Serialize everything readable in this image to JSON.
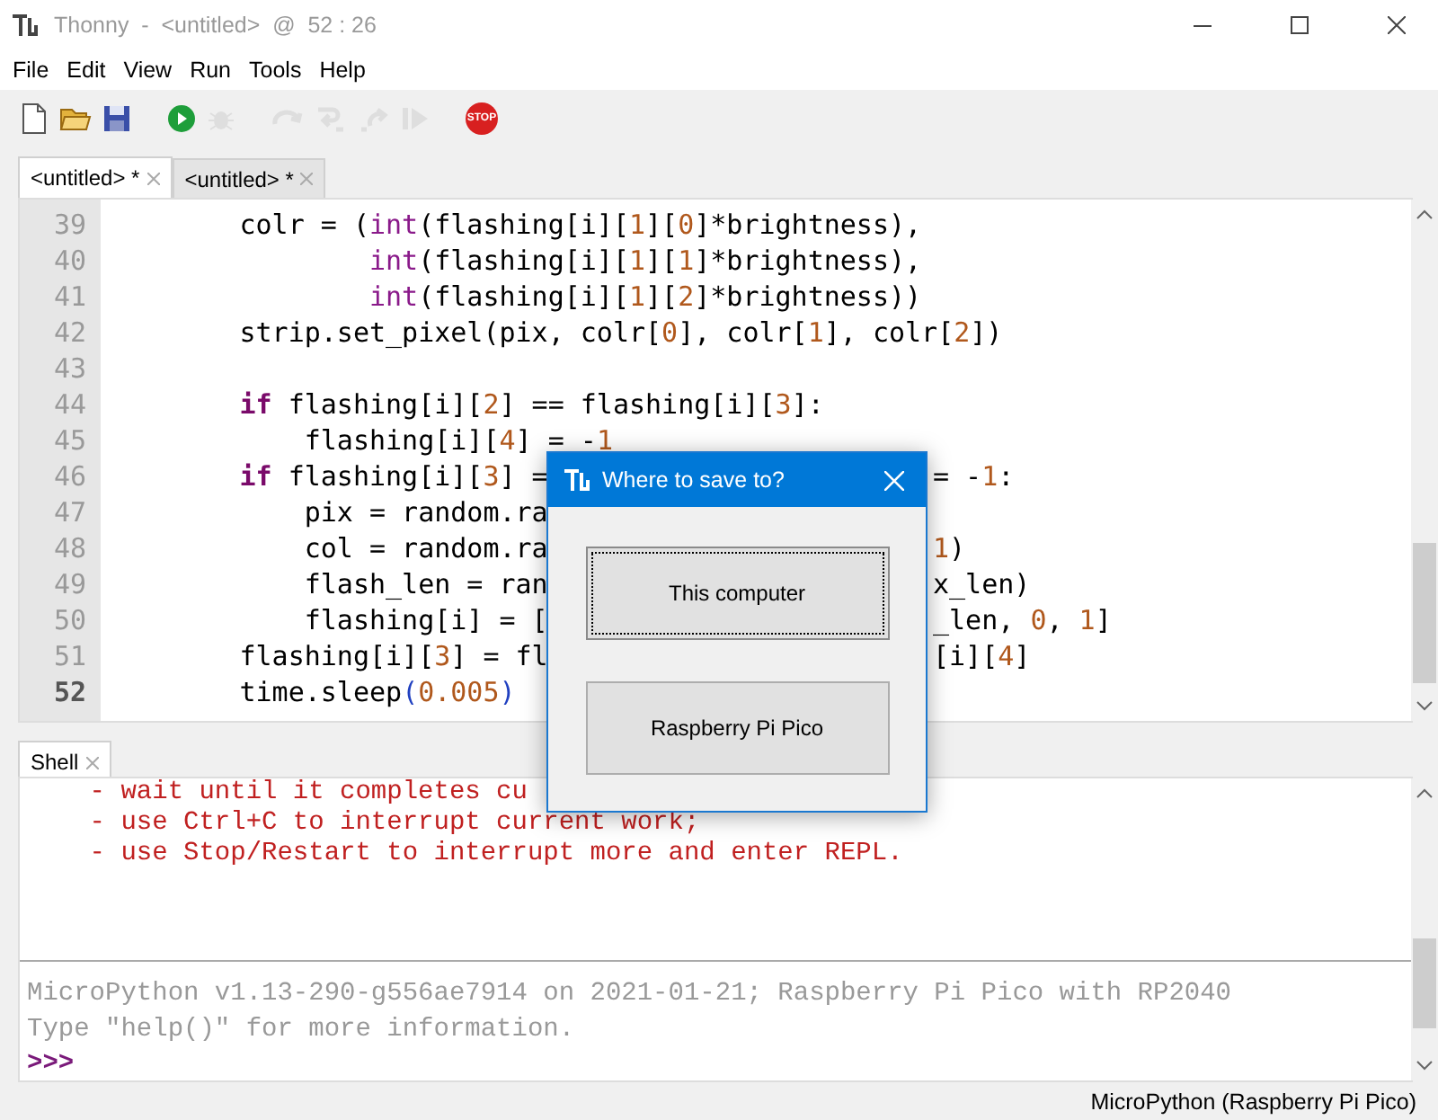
{
  "window": {
    "title": "Thonny  -  <untitled>  @  52 : 26"
  },
  "menu": [
    "File",
    "Edit",
    "View",
    "Run",
    "Tools",
    "Help"
  ],
  "toolbar": [
    {
      "kind": "new",
      "disabled": false
    },
    {
      "kind": "open",
      "disabled": false
    },
    {
      "kind": "save",
      "disabled": false
    },
    {
      "kind": "run",
      "disabled": false
    },
    {
      "kind": "debug",
      "disabled": true
    },
    {
      "kind": "step_over",
      "disabled": true
    },
    {
      "kind": "step_into",
      "disabled": true
    },
    {
      "kind": "step_out",
      "disabled": true
    },
    {
      "kind": "resume",
      "disabled": true
    },
    {
      "kind": "stop",
      "disabled": false,
      "label": "STOP"
    }
  ],
  "editor_tabs": [
    {
      "label": "<untitled> *",
      "selected": true
    },
    {
      "label": "<untitled> *",
      "selected": false
    }
  ],
  "code_lines": [
    {
      "number": "39",
      "current": false,
      "tokens": [
        {
          "text": "        colr = (",
          "kind": "plain"
        },
        {
          "text": "int",
          "kind": "builtin"
        },
        {
          "text": "(flashing[i][",
          "kind": "plain"
        },
        {
          "text": "1",
          "kind": "num"
        },
        {
          "text": "][",
          "kind": "plain"
        },
        {
          "text": "0",
          "kind": "num"
        },
        {
          "text": "]*brightness),",
          "kind": "plain"
        }
      ]
    },
    {
      "number": "40",
      "current": false,
      "tokens": [
        {
          "text": "                int",
          "kind": "builtin"
        },
        {
          "text": "(flashing[i][",
          "kind": "plain"
        },
        {
          "text": "1",
          "kind": "num"
        },
        {
          "text": "][",
          "kind": "plain"
        },
        {
          "text": "1",
          "kind": "num"
        },
        {
          "text": "]*brightness),",
          "kind": "plain"
        }
      ]
    },
    {
      "number": "41",
      "current": false,
      "tokens": [
        {
          "text": "                int",
          "kind": "builtin"
        },
        {
          "text": "(flashing[i][",
          "kind": "plain"
        },
        {
          "text": "1",
          "kind": "num"
        },
        {
          "text": "][",
          "kind": "plain"
        },
        {
          "text": "2",
          "kind": "num"
        },
        {
          "text": "]*brightness))",
          "kind": "plain"
        }
      ]
    },
    {
      "number": "42",
      "current": false,
      "tokens": [
        {
          "text": "        strip.set_pixel(pix, colr[",
          "kind": "plain"
        },
        {
          "text": "0",
          "kind": "num"
        },
        {
          "text": "], colr[",
          "kind": "plain"
        },
        {
          "text": "1",
          "kind": "num"
        },
        {
          "text": "], colr[",
          "kind": "plain"
        },
        {
          "text": "2",
          "kind": "num"
        },
        {
          "text": "])",
          "kind": "plain"
        }
      ]
    },
    {
      "number": "43",
      "current": false
    },
    {
      "number": "44",
      "current": false,
      "tokens": [
        {
          "text": "        if",
          "kind": "keyword"
        },
        {
          "text": " flashing[i][",
          "kind": "plain"
        },
        {
          "text": "2",
          "kind": "num"
        },
        {
          "text": "] == flashing[i][",
          "kind": "plain"
        },
        {
          "text": "3",
          "kind": "num"
        },
        {
          "text": "]:",
          "kind": "plain"
        }
      ]
    },
    {
      "number": "45",
      "current": false,
      "tokens": [
        {
          "text": "            flashing[i][",
          "kind": "plain"
        },
        {
          "text": "4",
          "kind": "num"
        },
        {
          "text": "] = -",
          "kind": "plain"
        },
        {
          "text": "1",
          "kind": "num"
        }
      ]
    },
    {
      "number": "46",
      "current": false,
      "tokens": [
        {
          "text": "        if",
          "kind": "keyword"
        },
        {
          "text": " flashing[i][",
          "kind": "plain"
        },
        {
          "text": "3",
          "kind": "num"
        },
        {
          "text": "] =",
          "kind": "plain"
        }
      ],
      "after_dialog": [
        {
          "text": "= -",
          "kind": "plain"
        },
        {
          "text": "1",
          "kind": "num"
        },
        {
          "text": ":",
          "kind": "plain"
        }
      ]
    },
    {
      "number": "47",
      "current": false,
      "tokens": [
        {
          "text": "            pix = random.ra",
          "kind": "plain"
        }
      ]
    },
    {
      "number": "48",
      "current": false,
      "tokens": [
        {
          "text": "            col = random.ra",
          "kind": "plain"
        }
      ],
      "after_dialog": [
        {
          "text": "1",
          "kind": "num"
        },
        {
          "text": ")",
          "kind": "plain"
        }
      ]
    },
    {
      "number": "49",
      "current": false,
      "tokens": [
        {
          "text": "            flash_len = ran",
          "kind": "plain"
        }
      ],
      "after_dialog": [
        {
          "text": "x_len)",
          "kind": "plain"
        }
      ]
    },
    {
      "number": "50",
      "current": false,
      "tokens": [
        {
          "text": "            flashing[i] = [",
          "kind": "plain"
        }
      ],
      "after_dialog": [
        {
          "text": "_len, ",
          "kind": "plain"
        },
        {
          "text": "0",
          "kind": "num"
        },
        {
          "text": ", ",
          "kind": "plain"
        },
        {
          "text": "1",
          "kind": "num"
        },
        {
          "text": "]",
          "kind": "plain"
        }
      ]
    },
    {
      "number": "51",
      "current": false,
      "tokens": [
        {
          "text": "        flashing[i][",
          "kind": "plain"
        },
        {
          "text": "3",
          "kind": "num"
        },
        {
          "text": "] = fl",
          "kind": "plain"
        }
      ],
      "after_dialog": [
        {
          "text": "[i][",
          "kind": "plain"
        },
        {
          "text": "4",
          "kind": "num"
        },
        {
          "text": "]",
          "kind": "plain"
        }
      ]
    },
    {
      "number": "52",
      "current": true,
      "tokens": [
        {
          "text": "        time.sleep",
          "kind": "plain"
        },
        {
          "text": "(",
          "kind": "paren"
        },
        {
          "text": "0.005",
          "kind": "num"
        },
        {
          "text": ")",
          "kind": "paren"
        }
      ]
    }
  ],
  "shell_tab": {
    "label": "Shell",
    "selected": true
  },
  "shell_output": [
    "    - wait until it completes cu",
    "    - use Ctrl+C to interrupt current work;",
    "    - use Stop/Restart to interrupt more and enter REPL."
  ],
  "shell_info": [
    "MicroPython v1.13-290-g556ae7914 on 2021-01-21; Raspberry Pi Pico with RP2040",
    "Type \"help()\" for more information."
  ],
  "shell_prompt": ">>>",
  "dialog": {
    "title": "Where to save to?",
    "buttons": [
      {
        "label": "This computer",
        "focused": true
      },
      {
        "label": "Raspberry Pi Pico",
        "focused": false
      }
    ]
  },
  "status_bar": "MicroPython (Raspberry Pi Pico)"
}
